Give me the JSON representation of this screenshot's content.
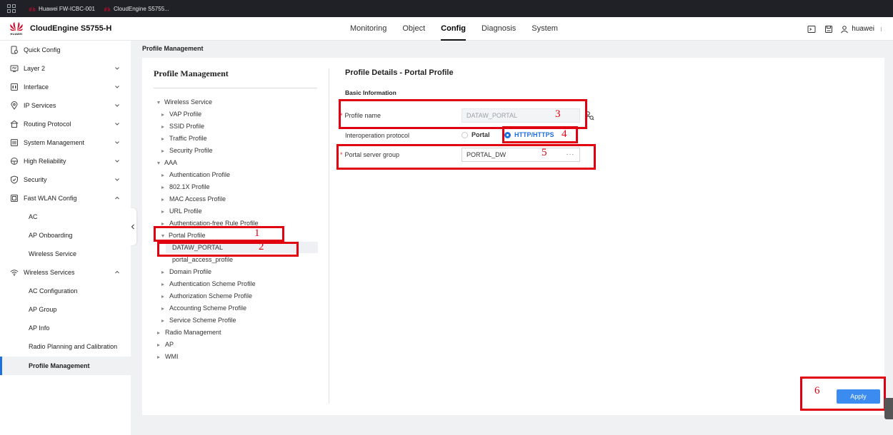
{
  "browser_tabs": [
    {
      "label": "Huawei FW-ICBC-001"
    },
    {
      "label": "CloudEngine S5755..."
    }
  ],
  "header": {
    "brand_word": "HUAWEI",
    "product": "CloudEngine S5755-H",
    "nav": [
      "Monitoring",
      "Object",
      "Config",
      "Diagnosis",
      "System"
    ],
    "active_nav": "Config",
    "user": "huawei"
  },
  "sidebar": {
    "items": [
      {
        "label": "Quick Config",
        "icon": "quick-config-icon",
        "expandable": false
      },
      {
        "label": "Layer 2",
        "icon": "layer2-icon",
        "expandable": true,
        "expanded": false
      },
      {
        "label": "Interface",
        "icon": "interface-icon",
        "expandable": true,
        "expanded": false
      },
      {
        "label": "IP Services",
        "icon": "ip-services-icon",
        "expandable": true,
        "expanded": false
      },
      {
        "label": "Routing Protocol",
        "icon": "routing-icon",
        "expandable": true,
        "expanded": false
      },
      {
        "label": "System Management",
        "icon": "system-management-icon",
        "expandable": true,
        "expanded": false
      },
      {
        "label": "High Reliability",
        "icon": "reliability-icon",
        "expandable": true,
        "expanded": false
      },
      {
        "label": "Security",
        "icon": "shield-icon",
        "expandable": true,
        "expanded": false
      },
      {
        "label": "Fast WLAN Config",
        "icon": "fast-wlan-icon",
        "expandable": true,
        "expanded": true
      },
      {
        "label": "Wireless Services",
        "icon": "wifi-icon",
        "expandable": true,
        "expanded": true
      }
    ],
    "fast_wlan_children": [
      "AC",
      "AP Onboarding",
      "Wireless Service"
    ],
    "wireless_children": [
      "AC Configuration",
      "AP Group",
      "AP Info",
      "Radio Planning and Calibration",
      "Profile Management"
    ],
    "active_child": "Profile Management"
  },
  "breadcrumb": "Profile Management",
  "profile_tree": {
    "title": "Profile Management",
    "nodes": [
      {
        "label": "Wireless Service",
        "level": 1,
        "state": "expanded"
      },
      {
        "label": "VAP Profile",
        "level": 2,
        "state": "collapsed"
      },
      {
        "label": "SSID Profile",
        "level": 2,
        "state": "collapsed"
      },
      {
        "label": "Traffic Profile",
        "level": 2,
        "state": "collapsed"
      },
      {
        "label": "Security Profile",
        "level": 2,
        "state": "collapsed"
      },
      {
        "label": "AAA",
        "level": 1,
        "state": "expanded"
      },
      {
        "label": "Authentication Profile",
        "level": 2,
        "state": "collapsed"
      },
      {
        "label": "802.1X Profile",
        "level": 2,
        "state": "collapsed"
      },
      {
        "label": "MAC Access Profile",
        "level": 2,
        "state": "collapsed"
      },
      {
        "label": "URL Profile",
        "level": 2,
        "state": "collapsed"
      },
      {
        "label": "Authentication-free Rule Profile",
        "level": 2,
        "state": "collapsed"
      },
      {
        "label": "Portal Profile",
        "level": 2,
        "state": "expanded"
      },
      {
        "label": "DATAW_PORTAL",
        "level": 3,
        "state": "leaf",
        "selected": true
      },
      {
        "label": "portal_access_profile",
        "level": 3,
        "state": "leaf"
      },
      {
        "label": "Domain Profile",
        "level": 2,
        "state": "collapsed"
      },
      {
        "label": "Authentication Scheme Profile",
        "level": 2,
        "state": "collapsed"
      },
      {
        "label": "Authorization Scheme Profile",
        "level": 2,
        "state": "collapsed"
      },
      {
        "label": "Accounting Scheme Profile",
        "level": 2,
        "state": "collapsed"
      },
      {
        "label": "Service Scheme Profile",
        "level": 2,
        "state": "collapsed"
      },
      {
        "label": "Radio Management",
        "level": 1,
        "state": "collapsed"
      },
      {
        "label": "AP",
        "level": 1,
        "state": "collapsed"
      },
      {
        "label": "WMI",
        "level": 1,
        "state": "collapsed"
      }
    ]
  },
  "details": {
    "title": "Profile Details - Portal Profile",
    "section": "Basic Information",
    "required_mark": "*",
    "profile_name_label": "Profile name",
    "profile_name_value": "DATAW_PORTAL",
    "interop_label": "Interoperation protocol",
    "interop_options": [
      "Portal",
      "HTTP/HTTPS"
    ],
    "interop_selected": "HTTP/HTTPS",
    "server_group_label": "Portal server group",
    "server_group_value": "PORTAL_DW",
    "more_label": "···",
    "apply_label": "Apply"
  },
  "annotations": [
    "1",
    "2",
    "3",
    "4",
    "5",
    "6"
  ],
  "colors": {
    "accent": "#1f6fde",
    "apply_button": "#3b8bf0",
    "annotation_red": "#e0000f",
    "huawei_red": "#cf0a2c"
  }
}
